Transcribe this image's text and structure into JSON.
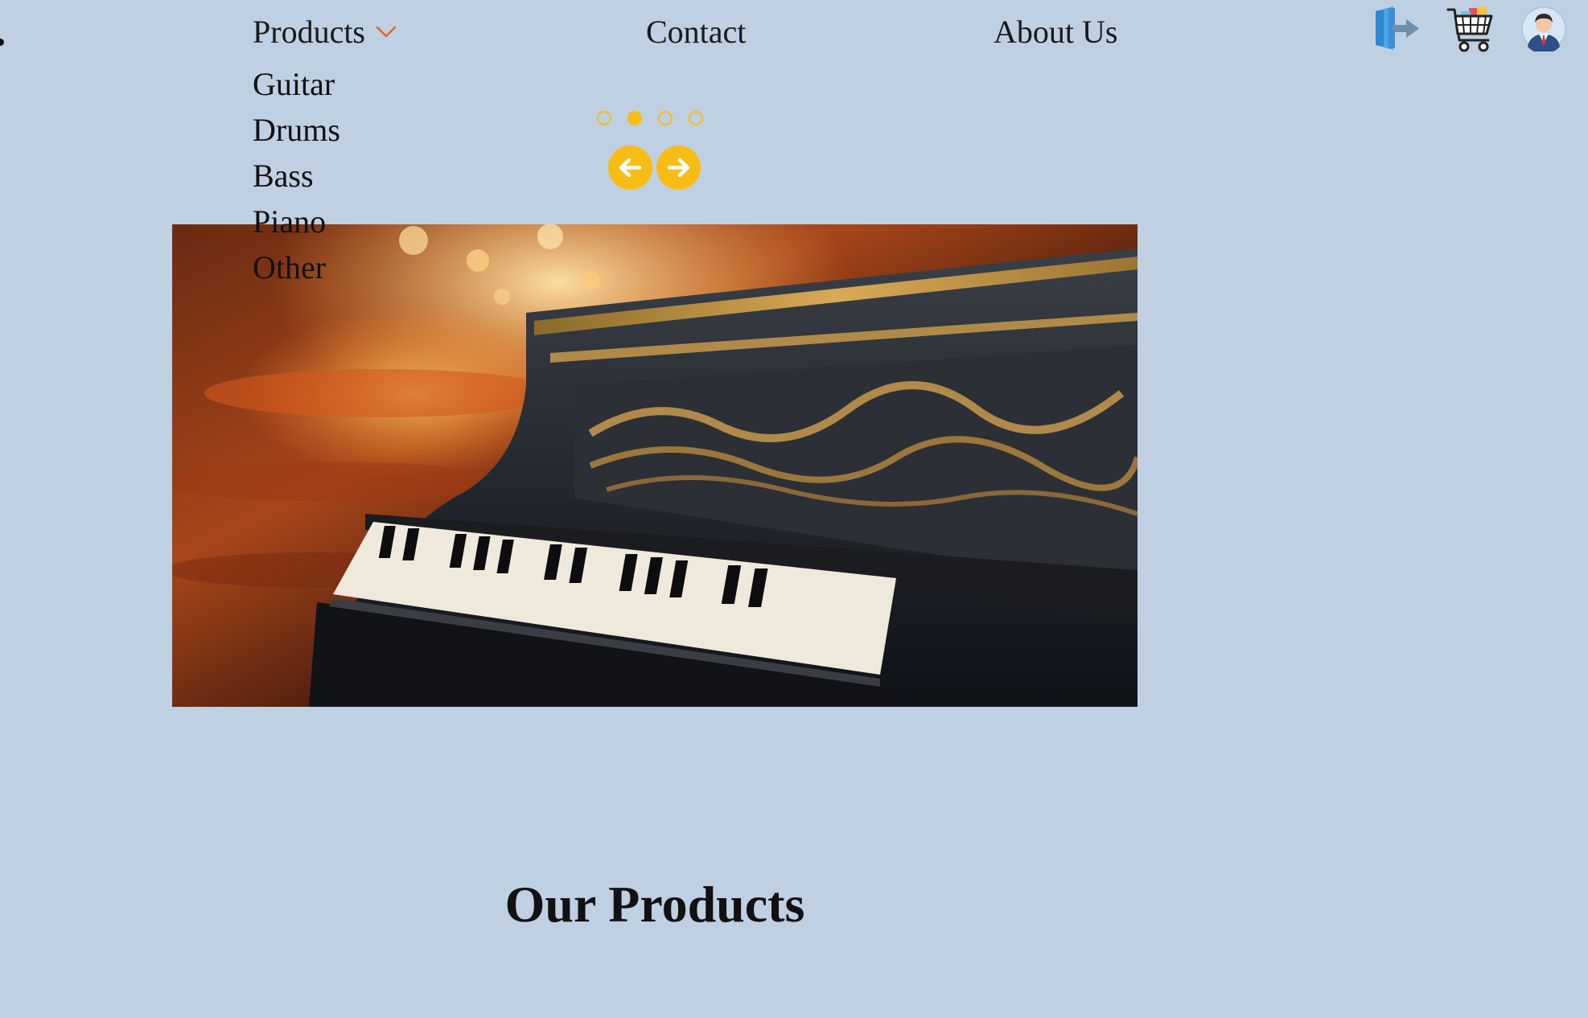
{
  "nav": {
    "products_label": "Products",
    "contact_label": "Contact",
    "about_label": "About Us"
  },
  "dropdown": {
    "items": [
      {
        "label": "Guitar"
      },
      {
        "label": "Drums"
      },
      {
        "label": "Bass"
      },
      {
        "label": "Piano"
      },
      {
        "label": "Other"
      }
    ]
  },
  "header_icons": {
    "logout": "logout-door-icon",
    "cart": "shopping-cart-icon",
    "user": "user-avatar-icon"
  },
  "carousel": {
    "slide_count": 4,
    "active_index": 1,
    "prev_icon": "arrow-left-icon",
    "next_icon": "arrow-right-icon",
    "current_image": "grand piano keyboard with ornate gold carving"
  },
  "sections": {
    "products_title": "Our Products"
  },
  "colors": {
    "page_background": "#bfd0e2",
    "accent": "#f7bd15",
    "chevron": "#e8622c"
  }
}
